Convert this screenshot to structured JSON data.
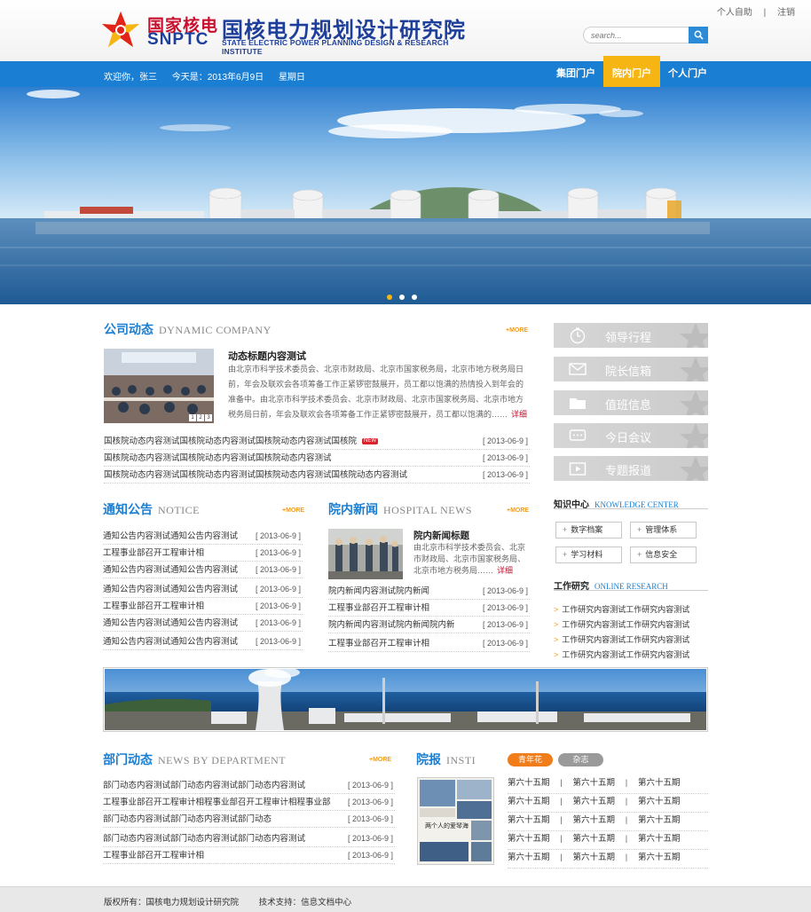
{
  "header": {
    "logo_cn_short": "国家核电",
    "logo_en_short": "SNPTC",
    "logo_cn_full": "国核电力规划设计研究院",
    "logo_en_full": "STATE ELECTRIC POWER PLANNING DESIGN & RESEARCH INSTITUTE",
    "personal_label": "个人自助",
    "separator": "|",
    "logout_label": "注销",
    "search_placeholder": "search..."
  },
  "nav": {
    "welcome": "欢迎你，张三",
    "today": "今天是：2013年6月9日",
    "weekday": "星期日",
    "portals": [
      {
        "label": "集团门户",
        "active": false
      },
      {
        "label": "院内门户",
        "active": true
      },
      {
        "label": "个人门户",
        "active": false
      }
    ]
  },
  "banner": {
    "slide_count": 3,
    "active_slide": 1
  },
  "company": {
    "title_cn": "公司动态",
    "title_en": "DYNAMIC COMPANY",
    "more": "+MORE",
    "headline": "动态标题内容测试",
    "summary": "由北京市科学技术委员会、北京市财政局、北京市国家税务局，北京市地方税务局日前，年会及联欢会各项筹备工作正紧锣密鼓展开，员工都以饱满的热情投入到年会的准备中。由北京市科学技术委员会、北京市财政局、北京市国家税务局、北京市地方税务局日前，年会及联欢会各项筹备工作正紧锣密鼓展开，员工都以饱满的……",
    "detail": "详细",
    "photo_pages": [
      "1",
      "2",
      "3"
    ],
    "items": [
      {
        "text": "国核院动态内容测试国核院动态内容测试国核院动态内容测试国核院",
        "date": "[ 2013-06-9 ]",
        "badge": "NEW"
      },
      {
        "text": "国核院动态内容测试国核院动态内容测试国核院动态内容测试",
        "date": "[ 2013-06-9 ]"
      },
      {
        "text": "国核院动态内容测试国核院动态内容测试国核院动态内容测试国核院动态内容测试",
        "date": "[ 2013-06-9 ]"
      }
    ]
  },
  "sidebar": {
    "buttons": [
      {
        "label": "领导行程",
        "icon": "clock-icon"
      },
      {
        "label": "院长信箱",
        "icon": "mail-icon"
      },
      {
        "label": "值班信息",
        "icon": "folder-icon"
      },
      {
        "label": "今日会议",
        "icon": "chat-icon"
      },
      {
        "label": "专题报道",
        "icon": "video-icon"
      }
    ],
    "knowledge_cn": "知识中心",
    "knowledge_en": "KNOWLEDGE CENTER",
    "knowledge_items": [
      "数字档案",
      "管理体系",
      "学习材料",
      "信息安全"
    ],
    "research_cn": "工作研究",
    "research_en": "ONLINE RESEARCH",
    "research_items": [
      "工作研究内容测试工作研究内容测试",
      "工作研究内容测试工作研究内容测试",
      "工作研究内容测试工作研究内容测试",
      "工作研究内容测试工作研究内容测试"
    ]
  },
  "notice": {
    "title_cn": "通知公告",
    "title_en": "NOTICE",
    "more": "+MORE",
    "items": [
      {
        "text": "通知公告内容测试通知公告内容测试",
        "date": "[ 2013-06-9 ]"
      },
      {
        "text": "工程事业部召开工程审计相",
        "date": "[ 2013-06-9 ]"
      },
      {
        "text": "通知公告内容测试通知公告内容测试",
        "date": "[ 2013-06-9 ]"
      },
      {
        "text": "通知公告内容测试通知公告内容测试",
        "date": "[ 2013-06-9 ]"
      },
      {
        "text": "工程事业部召开工程审计相",
        "date": "[ 2013-06-9 ]"
      },
      {
        "text": "通知公告内容测试通知公告内容测试",
        "date": "[ 2013-06-9 ]"
      },
      {
        "text": "通知公告内容测试通知公告内容测试",
        "date": "[ 2013-06-9 ]"
      }
    ]
  },
  "hospital": {
    "title_cn": "院内新闻",
    "title_en": "HOSPITAL NEWS",
    "more": "+MORE",
    "headline": "院内新闻标题",
    "summary": "由北京市科学技术委员会、北京市财政局、北京市国家税务局、北京市地方税务局……",
    "detail": "详细",
    "items": [
      {
        "text": "院内新闻内容测试院内新闻",
        "date": "[ 2013-06-9 ]"
      },
      {
        "text": "工程事业部召开工程审计相",
        "date": "[ 2013-06-9 ]"
      },
      {
        "text": "院内新闻内容测试院内新闻院内新",
        "date": "[ 2013-06-9 ]"
      },
      {
        "text": "工程事业部召开工程审计相",
        "date": "[ 2013-06-9 ]"
      }
    ]
  },
  "department": {
    "title_cn": "部门动态",
    "title_en": "NEWS BY DEPARTMENT",
    "more": "+MORE",
    "items": [
      {
        "text": "部门动态内容测试部门动态内容测试部门动态内容测试",
        "date": "[ 2013-06-9 ]"
      },
      {
        "text": "工程事业部召开工程审计相程事业部召开工程审计相程事业部",
        "date": "[ 2013-06-9 ]"
      },
      {
        "text": "部门动态内容测试部门动态内容测试部门动态",
        "date": "[ 2013-06-9 ]"
      },
      {
        "text": "部门动态内容测试部门动态内容测试部门动态内容测试",
        "date": "[ 2013-06-9 ]"
      },
      {
        "text": "工程事业部召开工程审计相",
        "date": "[ 2013-06-9 ]"
      }
    ]
  },
  "magazine": {
    "title_cn": "院报",
    "title_en": "INSTI",
    "tabs": [
      {
        "label": "青年花",
        "active": true,
        "color": "#f07c1a"
      },
      {
        "label": "杂志",
        "active": false,
        "color": "#9a9a9a"
      }
    ],
    "issues": [
      [
        "第六十五期",
        "第六十五期",
        "第六十五期"
      ],
      [
        "第六十五期",
        "第六十五期",
        "第六十五期"
      ],
      [
        "第六十五期",
        "第六十五期",
        "第六十五期"
      ],
      [
        "第六十五期",
        "第六十五期",
        "第六十五期"
      ],
      [
        "第六十五期",
        "第六十五期",
        "第六十五期"
      ]
    ],
    "issue_sep": "|",
    "cover_text": "两个人的爱琴海"
  },
  "footer": {
    "copyright": "版权所有：国核电力规划设计研究院",
    "support": "技术支持：信息文档中心"
  },
  "colors": {
    "brand_blue": "#1a7fd3",
    "accent_yellow": "#f6b512",
    "accent_red": "#c8102e",
    "more_orange": "#f39c12"
  }
}
